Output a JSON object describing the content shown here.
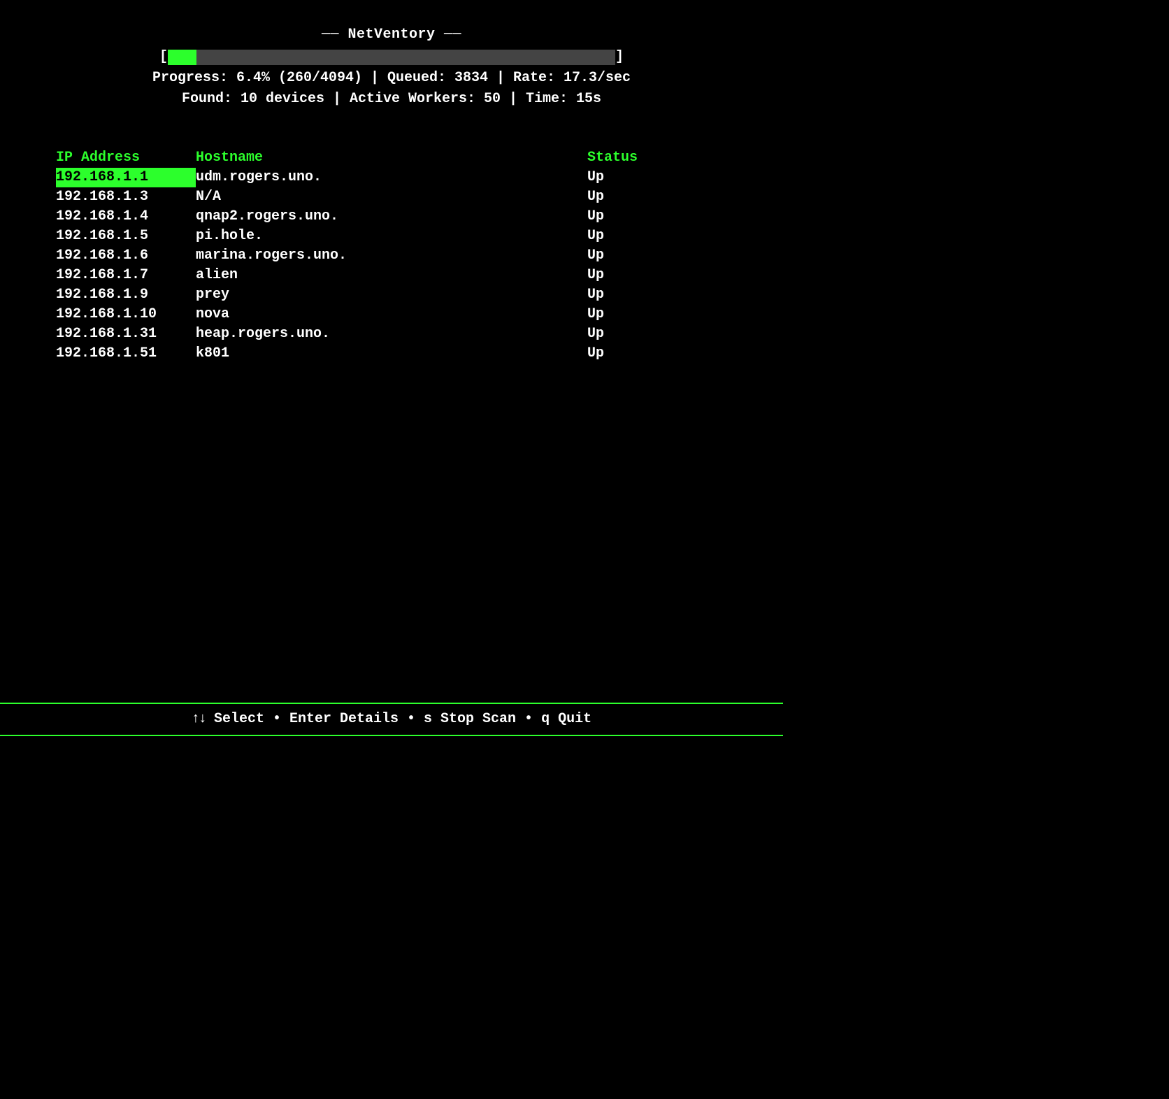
{
  "title": "── NetVentory ──",
  "progress": {
    "percent": 6.4,
    "line1": "Progress: 6.4% (260/4094) | Queued: 3834 | Rate: 17.3/sec",
    "line2": "Found: 10 devices | Active Workers: 50 | Time: 15s",
    "bracket_open": "[",
    "bracket_close": "]"
  },
  "columns": {
    "ip": "IP Address",
    "hostname": "Hostname",
    "status": "Status"
  },
  "rows": [
    {
      "ip": "192.168.1.1",
      "hostname": "udm.rogers.uno.",
      "status": "Up",
      "selected": true
    },
    {
      "ip": "192.168.1.3",
      "hostname": "N/A",
      "status": "Up",
      "selected": false
    },
    {
      "ip": "192.168.1.4",
      "hostname": "qnap2.rogers.uno.",
      "status": "Up",
      "selected": false
    },
    {
      "ip": "192.168.1.5",
      "hostname": "pi.hole.",
      "status": "Up",
      "selected": false
    },
    {
      "ip": "192.168.1.6",
      "hostname": "marina.rogers.uno.",
      "status": "Up",
      "selected": false
    },
    {
      "ip": "192.168.1.7",
      "hostname": "alien",
      "status": "Up",
      "selected": false
    },
    {
      "ip": "192.168.1.9",
      "hostname": "prey",
      "status": "Up",
      "selected": false
    },
    {
      "ip": "192.168.1.10",
      "hostname": "nova",
      "status": "Up",
      "selected": false
    },
    {
      "ip": "192.168.1.31",
      "hostname": "heap.rogers.uno.",
      "status": "Up",
      "selected": false
    },
    {
      "ip": "192.168.1.51",
      "hostname": "k801",
      "status": "Up",
      "selected": false
    }
  ],
  "footer": {
    "arrows": "↑↓",
    "select": " Select ",
    "sep": "• ",
    "enter": "Enter Details ",
    "stop": "s Stop Scan ",
    "quit": "q Quit"
  },
  "colors": {
    "accent": "#2cff2c",
    "bar_bg": "#444"
  }
}
